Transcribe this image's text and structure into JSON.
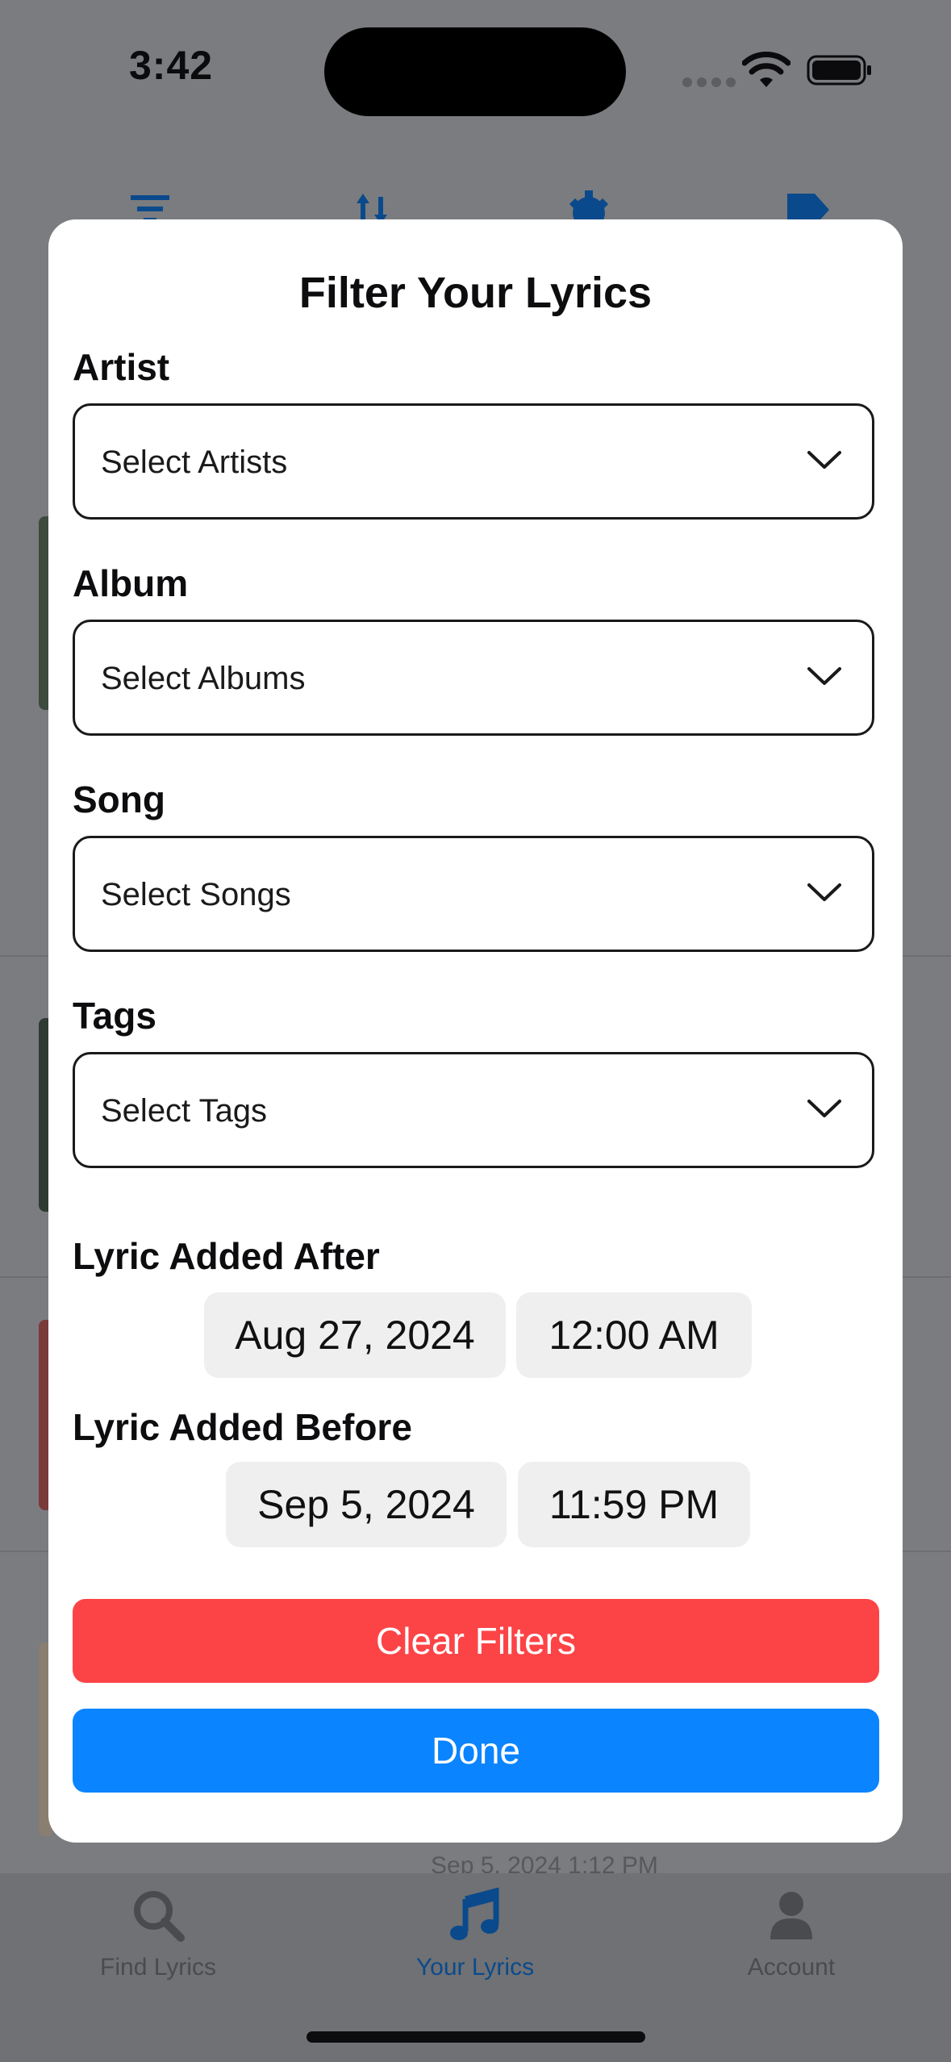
{
  "status_bar": {
    "time": "3:42"
  },
  "modal": {
    "title": "Filter Your Lyrics",
    "artist": {
      "label": "Artist",
      "placeholder": "Select Artists"
    },
    "album": {
      "label": "Album",
      "placeholder": "Select Albums"
    },
    "song": {
      "label": "Song",
      "placeholder": "Select Songs"
    },
    "tags": {
      "label": "Tags",
      "placeholder": "Select Tags"
    },
    "added_after": {
      "label": "Lyric Added After",
      "date": "Aug 27, 2024",
      "time": "12:00 AM"
    },
    "added_before": {
      "label": "Lyric Added Before",
      "date": "Sep 5, 2024",
      "time": "11:59 PM"
    },
    "clear_button": "Clear Filters",
    "done_button": "Done"
  },
  "background": {
    "timestamp": "Sep 5, 2024 1:12 PM"
  },
  "tabbar": {
    "tabs": [
      {
        "label": "Find Lyrics",
        "icon": "search-icon",
        "active": false
      },
      {
        "label": "Your Lyrics",
        "icon": "music-note-icon",
        "active": true
      },
      {
        "label": "Account",
        "icon": "person-icon",
        "active": false
      }
    ]
  },
  "colors": {
    "accent": "#0a84ff",
    "danger": "#fc4447",
    "active_tab": "#0a4a8c",
    "inactive_tab": "#4a4b4e"
  }
}
